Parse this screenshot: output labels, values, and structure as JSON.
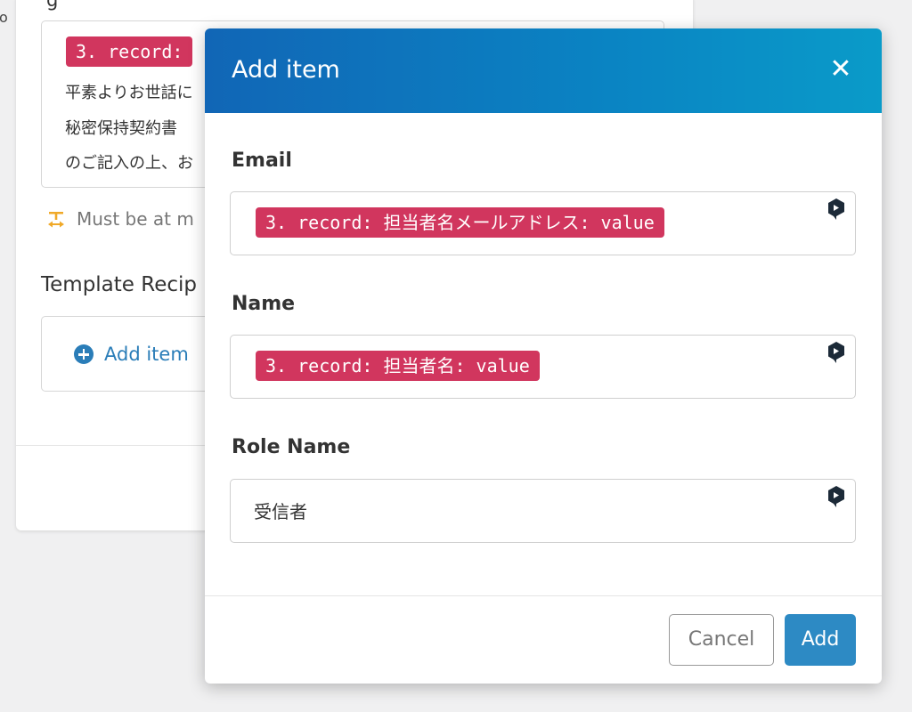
{
  "background": {
    "edge_fragment": "o",
    "top_label": "g",
    "textarea": {
      "pill": "3. record:",
      "lines": [
        "平素よりお世話に",
        "秘密保持契約書",
        "のご記入の上、お"
      ]
    },
    "hint": "Must be at m",
    "section_label": "Template Recip",
    "add_item_label": "Add item"
  },
  "modal": {
    "title": "Add item",
    "close_symbol": "✕",
    "fields": [
      {
        "label": "Email",
        "pill": "3. record: 担当者名メールアドレス: value"
      },
      {
        "label": "Name",
        "pill": "3. record: 担当者名: value"
      },
      {
        "label": "Role Name",
        "value": "受信者"
      }
    ],
    "cancel_label": "Cancel",
    "add_label": "Add"
  },
  "colors": {
    "pill": "#d1365e",
    "header_start": "#1166b6",
    "header_end": "#0a9bc9",
    "primary_button": "#2d8ac4",
    "link": "#2a7db8",
    "hint_icon": "#f0a928"
  },
  "icons": {
    "field_mapping": "mapping-badge-icon",
    "hint": "text-width-icon",
    "add": "plus-circle-icon",
    "close": "close-icon"
  }
}
